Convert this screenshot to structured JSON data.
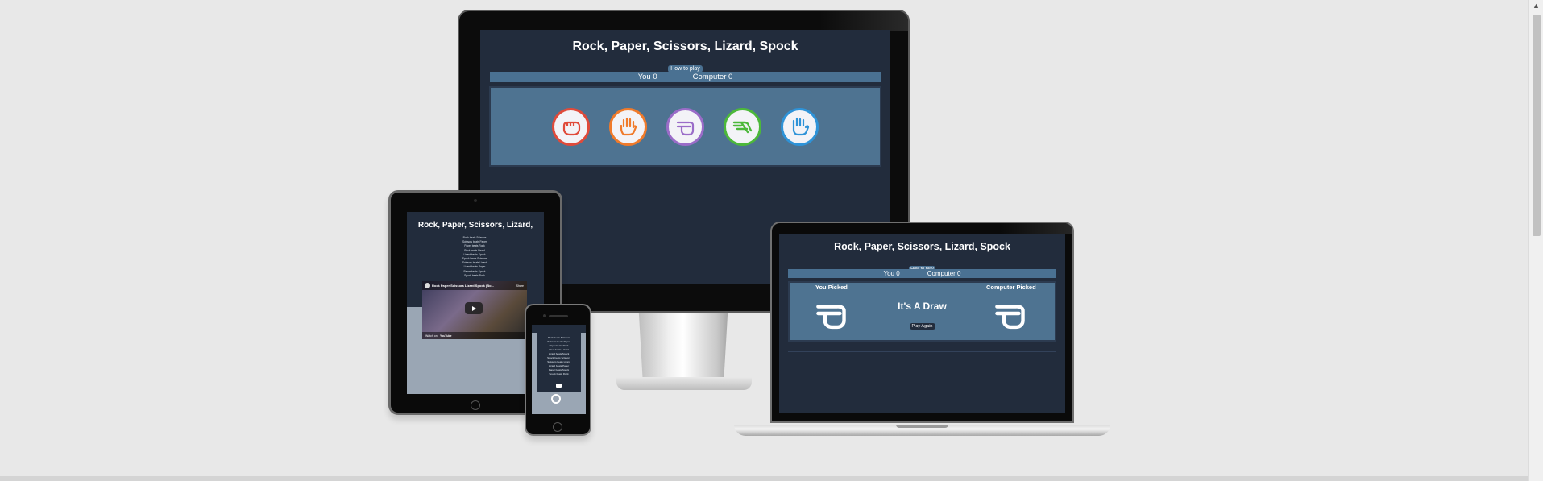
{
  "game": {
    "title": "Rock, Paper, Scissors, Lizard, Spock",
    "tablet_title": "Rock, Paper, Scissors, Lizard,",
    "how_to_play": "How to play",
    "score_you": "You 0",
    "score_computer": "Computer 0",
    "choices": [
      {
        "name": "rock",
        "color": "#e04a3a"
      },
      {
        "name": "paper",
        "color": "#f07a2a"
      },
      {
        "name": "scissors",
        "color": "#9a6cc8"
      },
      {
        "name": "lizard",
        "color": "#4cb83a"
      },
      {
        "name": "spock",
        "color": "#2e93d8"
      }
    ],
    "result": {
      "you_picked": "You Picked",
      "computer_picked": "Computer Picked",
      "message": "It's A Draw",
      "play_again": "Play Again"
    }
  },
  "rules": [
    "Rock beats Scissors",
    "Scissors beats Paper",
    "Paper beats Rock",
    "Rock beats Lizard",
    "Lizard beats Spock",
    "Spock beats Scissors",
    "Scissors beats Lizard",
    "Lizard beats Paper",
    "Paper beats Spock",
    "Spock beats Rock"
  ],
  "video": {
    "title": "Rock Paper Scissors Lizard Spock (Bo...",
    "share": "Share",
    "watch_on": "Watch on",
    "platform": "YouTube"
  }
}
